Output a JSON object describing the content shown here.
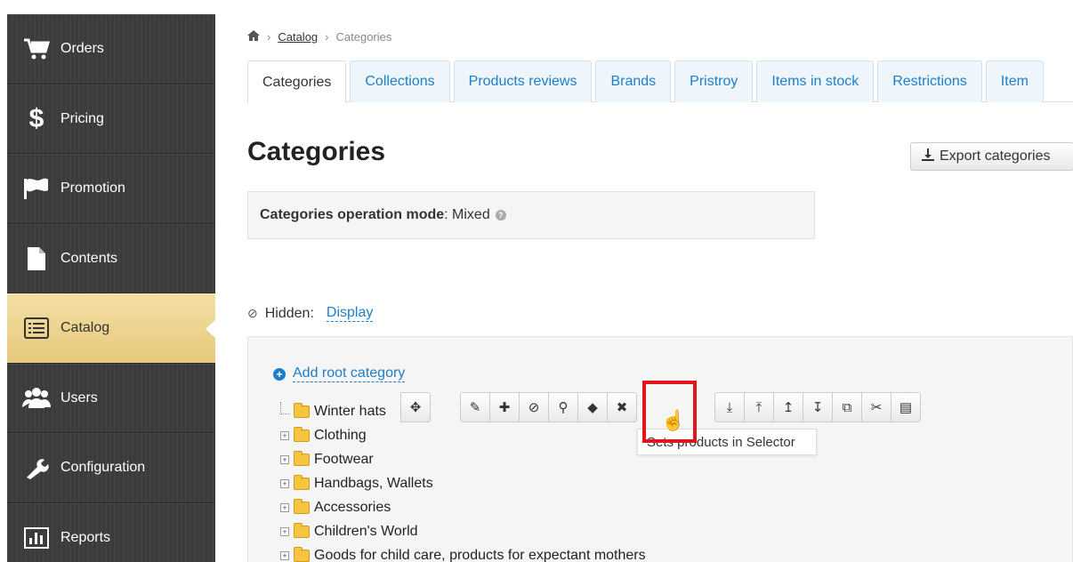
{
  "sidebar": {
    "items": [
      {
        "label": "Orders",
        "icon": "cart-icon"
      },
      {
        "label": "Pricing",
        "icon": "dollar-icon"
      },
      {
        "label": "Promotion",
        "icon": "flag-icon"
      },
      {
        "label": "Contents",
        "icon": "file-icon"
      },
      {
        "label": "Catalog",
        "icon": "list-icon",
        "active": true
      },
      {
        "label": "Users",
        "icon": "users-icon"
      },
      {
        "label": "Configuration",
        "icon": "wrench-icon"
      },
      {
        "label": "Reports",
        "icon": "bar-chart-icon"
      }
    ]
  },
  "breadcrumb": {
    "home_icon": "home-icon",
    "catalog": "Catalog",
    "current": "Categories",
    "separator": "›"
  },
  "tabs": [
    {
      "label": "Categories",
      "active": true
    },
    {
      "label": "Collections"
    },
    {
      "label": "Products reviews"
    },
    {
      "label": "Brands"
    },
    {
      "label": "Pristroy"
    },
    {
      "label": "Items in stock"
    },
    {
      "label": "Restrictions"
    },
    {
      "label": "Item"
    }
  ],
  "page": {
    "title": "Categories",
    "export_label": "Export categories",
    "mode_label": "Categories operation mode",
    "mode_value": ": Mixed",
    "hidden_label": "Hidden:",
    "hidden_link": "Display",
    "add_root": "Add root category",
    "tooltip": "Sets products in Selector"
  },
  "tree": [
    {
      "label": "Winter hats",
      "expandable": false
    },
    {
      "label": "Clothing",
      "expandable": true
    },
    {
      "label": "Footwear",
      "expandable": true
    },
    {
      "label": "Handbags, Wallets",
      "expandable": true
    },
    {
      "label": "Accessories",
      "expandable": true
    },
    {
      "label": "Children's World",
      "expandable": true
    },
    {
      "label": "Goods for child care, products for expectant mothers",
      "expandable": true
    }
  ],
  "toolbar": {
    "move": {
      "icon": "move-icon",
      "glyph": "✥"
    },
    "group1": [
      {
        "icon": "pencil-icon",
        "glyph": "✎"
      },
      {
        "icon": "plus-icon",
        "glyph": "✚"
      },
      {
        "icon": "eye-slash-icon",
        "glyph": "⊘"
      },
      {
        "icon": "search-icon",
        "glyph": "⚲"
      },
      {
        "icon": "tag-icon",
        "glyph": "◆"
      },
      {
        "icon": "close-icon",
        "glyph": "✖"
      }
    ],
    "group2": [
      {
        "icon": "download-icon",
        "glyph": "⤓"
      },
      {
        "icon": "upload-icon",
        "glyph": "⤒"
      },
      {
        "icon": "arrow-up-icon",
        "glyph": "↥"
      },
      {
        "icon": "arrow-down-icon",
        "glyph": "↧"
      },
      {
        "icon": "copy-icon",
        "glyph": "⧉"
      },
      {
        "icon": "cut-icon",
        "glyph": "✂"
      },
      {
        "icon": "paste-icon",
        "glyph": "▤"
      }
    ]
  },
  "colors": {
    "sidebar_bg": "#3b3b3b",
    "active_bg": "#e6c97c",
    "link": "#1e7ec8",
    "highlight": "#e0161c"
  }
}
